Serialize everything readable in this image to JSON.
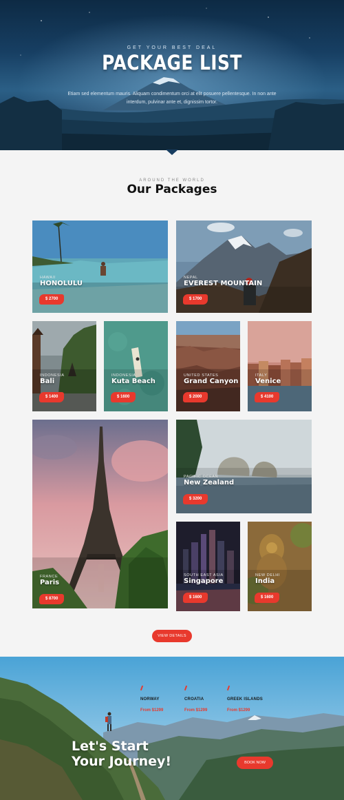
{
  "hero": {
    "eyebrow": "GET YOUR BEST DEAL",
    "title": "PACKAGE LIST",
    "description": "Etiam sed elementum mauris. Aliquam condimentum orci at elit posuere pellentesque. In non ante interdum, pulvinar ante et, dignissim tortor."
  },
  "packages_section": {
    "eyebrow": "AROUND THE WORLD",
    "title": "Our Packages"
  },
  "packages": [
    {
      "region": "HAWAII",
      "name": "HONOLULU",
      "price": "$ 2700"
    },
    {
      "region": "NEPAL",
      "name": "EVEREST MOUNTAIN",
      "price": "$ 1700"
    },
    {
      "region": "INDONESIA",
      "name": "Bali",
      "price": "$ 1400"
    },
    {
      "region": "INDONESIA",
      "name": "Kuta Beach",
      "price": "$ 1600"
    },
    {
      "region": "UNITED STATES",
      "name": "Grand Canyon",
      "price": "$ 2000"
    },
    {
      "region": "ITALY",
      "name": "Venice",
      "price": "$ 4100"
    },
    {
      "region": "FRANCE",
      "name": "Paris",
      "price": "$ 8700"
    },
    {
      "region": "PACIFIC OCEAN",
      "name": "New Zealand",
      "price": "$ 3200"
    },
    {
      "region": "SOUTH EAST ASIA",
      "name": "Singapore",
      "price": "$ 1600"
    },
    {
      "region": "NEW DELHI",
      "name": "India",
      "price": "$ 1600"
    }
  ],
  "view_details_label": "VIEW DETAILS",
  "journey": {
    "destinations": [
      {
        "name": "NORWAY",
        "price": "From $1299"
      },
      {
        "name": "CROATIA",
        "price": "From $1299"
      },
      {
        "name": "GREEK ISLANDS",
        "price": "From $1299"
      }
    ],
    "title_line1": "Let's Start",
    "title_line2": "Your Journey!",
    "book_label": "BOOK NOW"
  },
  "colors": {
    "accent": "#e8392d",
    "page_bg": "#f4f4f4"
  }
}
